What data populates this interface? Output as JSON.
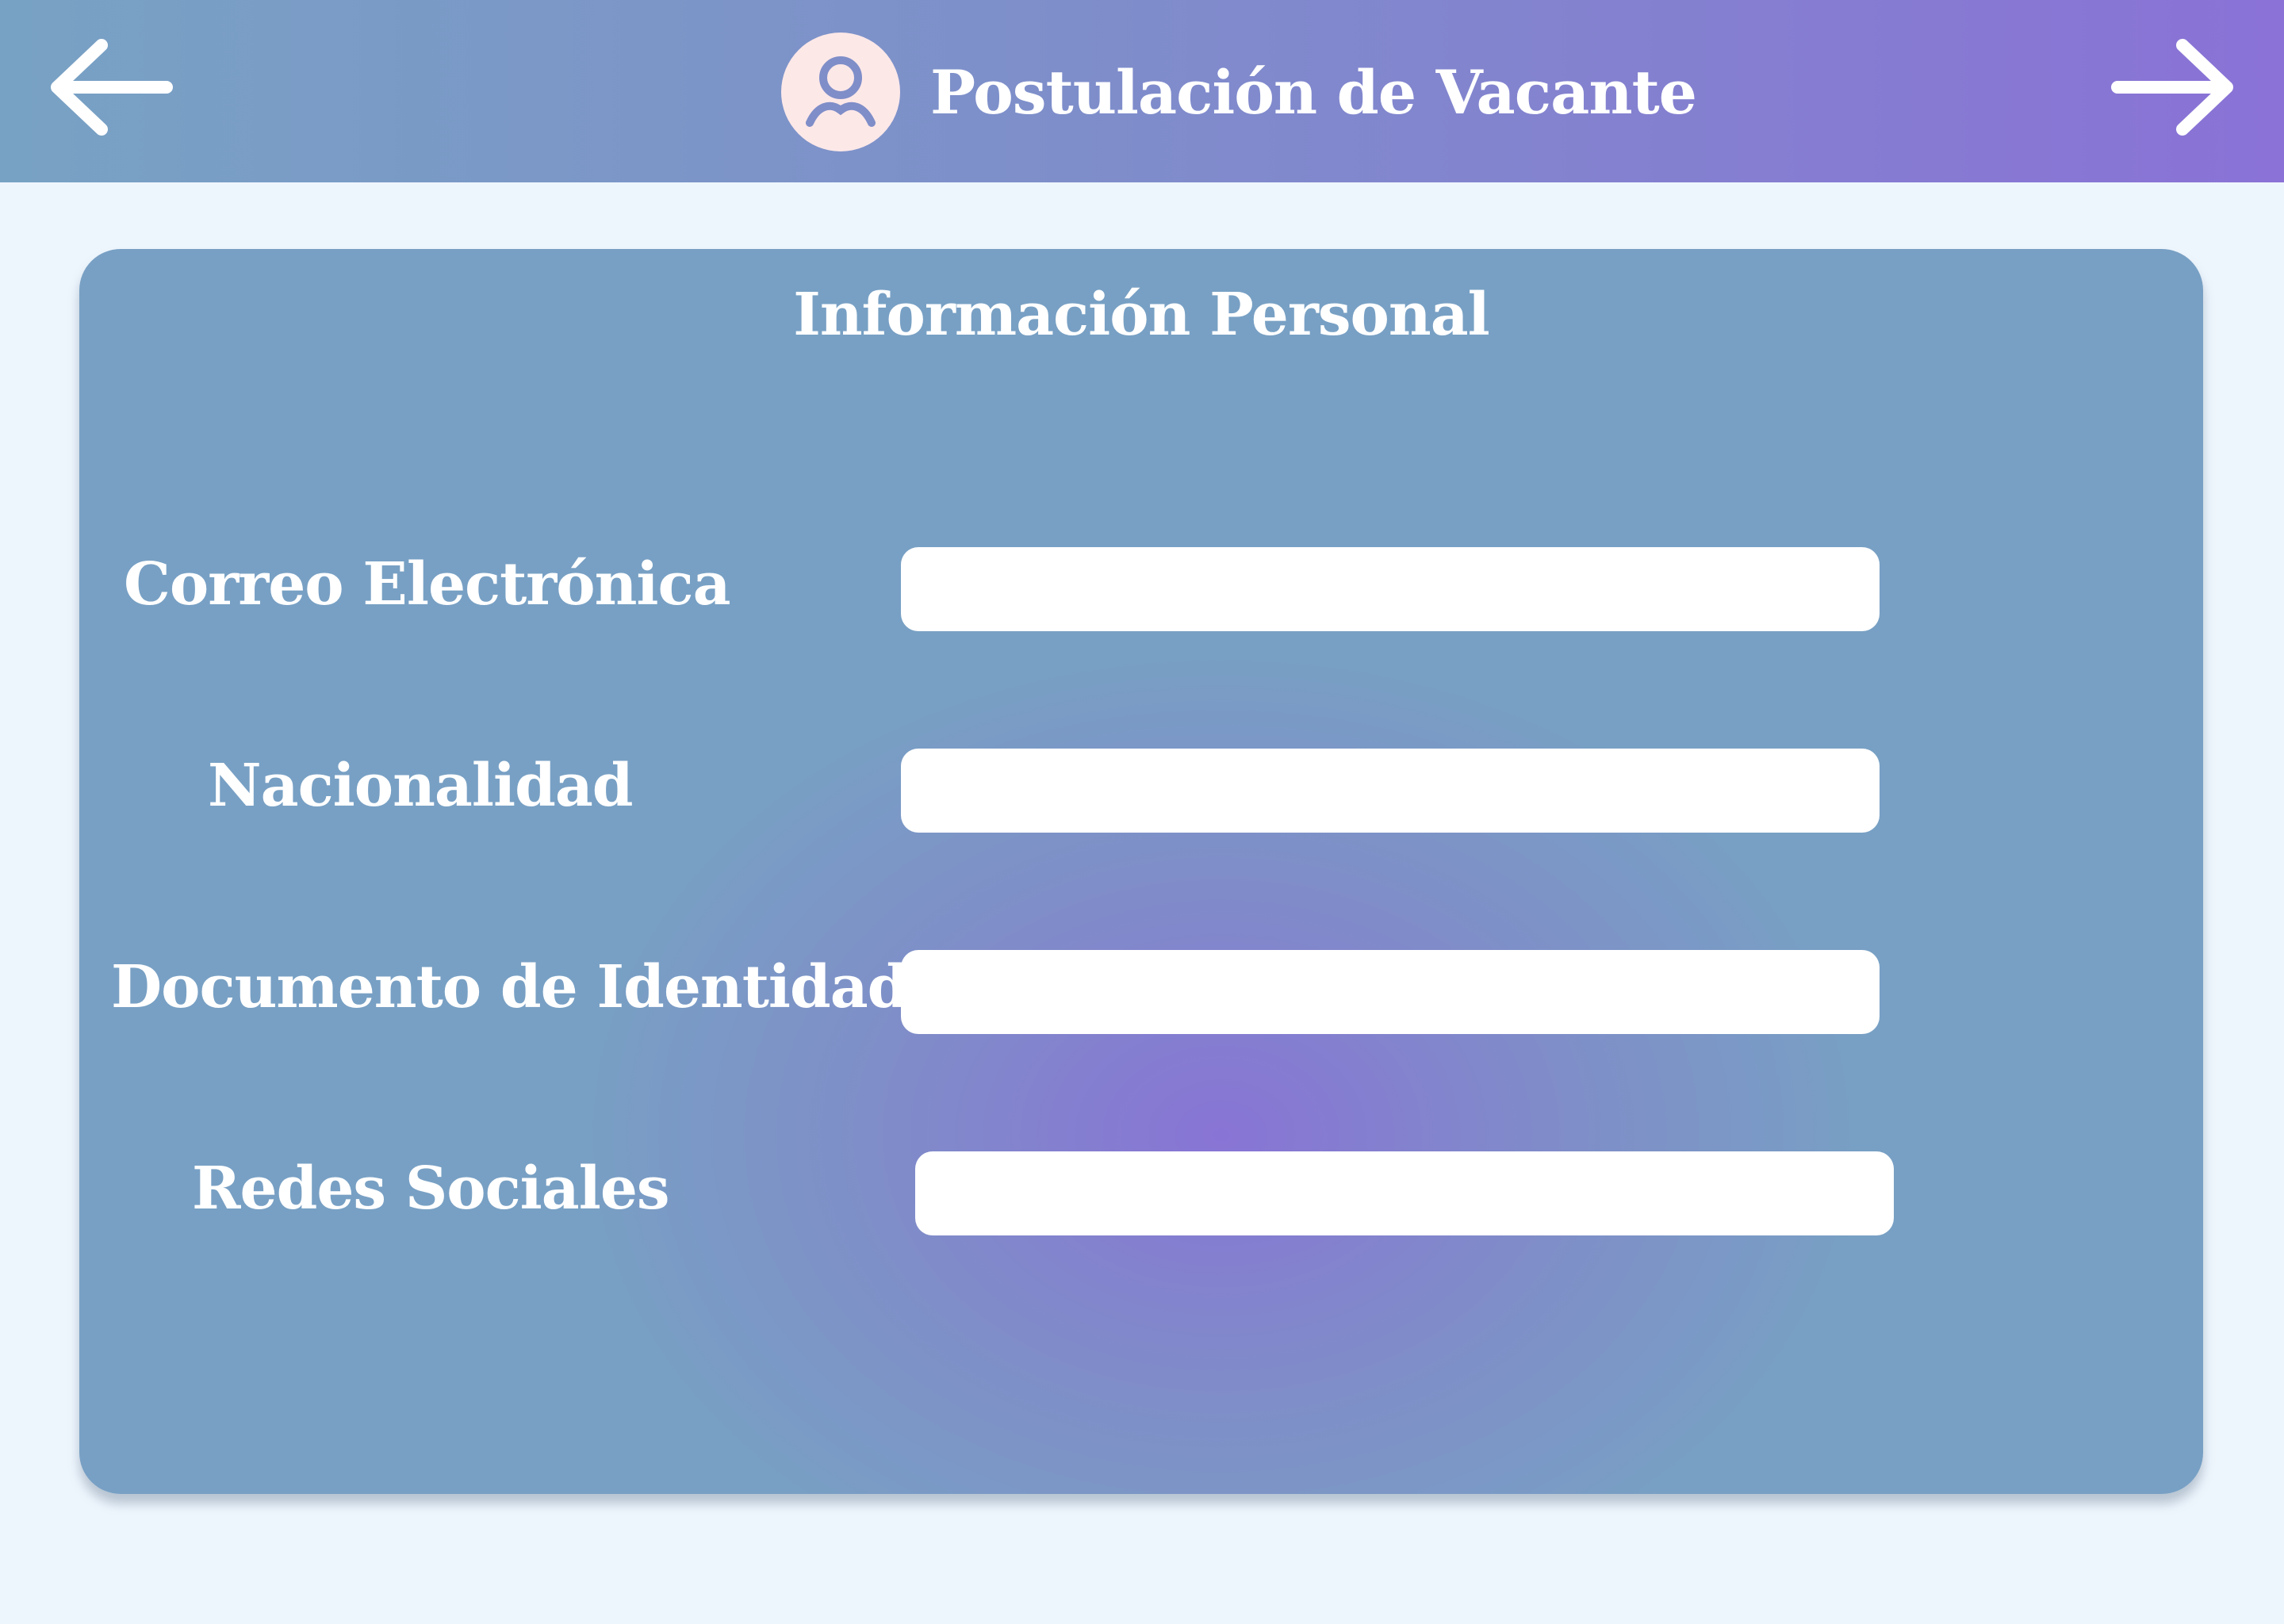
{
  "header": {
    "title": "Postulación de Vacante",
    "back_icon": "arrow-left-icon",
    "forward_icon": "arrow-right-icon",
    "avatar_icon": "user-profile-icon"
  },
  "form": {
    "title": "Información Personal",
    "fields": [
      {
        "label": "Correo Electrónica",
        "value": ""
      },
      {
        "label": "Nacionalidad",
        "value": ""
      },
      {
        "label": "Documento de Identidad",
        "value": ""
      },
      {
        "label": "Redes Sociales",
        "value": ""
      }
    ]
  },
  "colors": {
    "header_start": "#78a2c4",
    "header_end": "#8a72d6",
    "card_base": "#78a0c4",
    "card_glow": "#8874d5",
    "page_background": "#eef6fd",
    "avatar_background": "#fde8e8",
    "avatar_figure": "#7f8ec8"
  }
}
